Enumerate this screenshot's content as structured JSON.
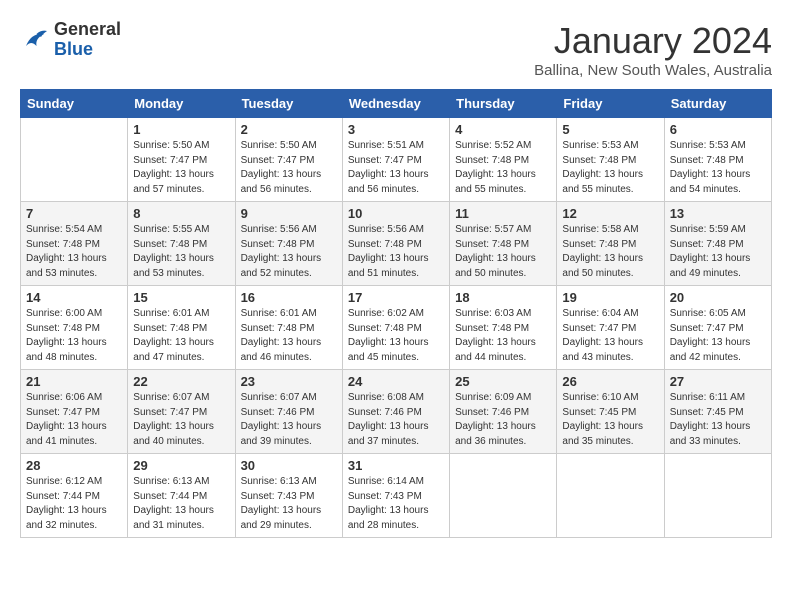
{
  "header": {
    "logo_general": "General",
    "logo_blue": "Blue",
    "title": "January 2024",
    "location": "Ballina, New South Wales, Australia"
  },
  "days_of_week": [
    "Sunday",
    "Monday",
    "Tuesday",
    "Wednesday",
    "Thursday",
    "Friday",
    "Saturday"
  ],
  "weeks": [
    [
      {
        "day": "",
        "sunrise": "",
        "sunset": "",
        "daylight": ""
      },
      {
        "day": "1",
        "sunrise": "5:50 AM",
        "sunset": "7:47 PM",
        "daylight": "13 hours and 57 minutes."
      },
      {
        "day": "2",
        "sunrise": "5:50 AM",
        "sunset": "7:47 PM",
        "daylight": "13 hours and 56 minutes."
      },
      {
        "day": "3",
        "sunrise": "5:51 AM",
        "sunset": "7:47 PM",
        "daylight": "13 hours and 56 minutes."
      },
      {
        "day": "4",
        "sunrise": "5:52 AM",
        "sunset": "7:48 PM",
        "daylight": "13 hours and 55 minutes."
      },
      {
        "day": "5",
        "sunrise": "5:53 AM",
        "sunset": "7:48 PM",
        "daylight": "13 hours and 55 minutes."
      },
      {
        "day": "6",
        "sunrise": "5:53 AM",
        "sunset": "7:48 PM",
        "daylight": "13 hours and 54 minutes."
      }
    ],
    [
      {
        "day": "7",
        "sunrise": "5:54 AM",
        "sunset": "7:48 PM",
        "daylight": "13 hours and 53 minutes."
      },
      {
        "day": "8",
        "sunrise": "5:55 AM",
        "sunset": "7:48 PM",
        "daylight": "13 hours and 53 minutes."
      },
      {
        "day": "9",
        "sunrise": "5:56 AM",
        "sunset": "7:48 PM",
        "daylight": "13 hours and 52 minutes."
      },
      {
        "day": "10",
        "sunrise": "5:56 AM",
        "sunset": "7:48 PM",
        "daylight": "13 hours and 51 minutes."
      },
      {
        "day": "11",
        "sunrise": "5:57 AM",
        "sunset": "7:48 PM",
        "daylight": "13 hours and 50 minutes."
      },
      {
        "day": "12",
        "sunrise": "5:58 AM",
        "sunset": "7:48 PM",
        "daylight": "13 hours and 50 minutes."
      },
      {
        "day": "13",
        "sunrise": "5:59 AM",
        "sunset": "7:48 PM",
        "daylight": "13 hours and 49 minutes."
      }
    ],
    [
      {
        "day": "14",
        "sunrise": "6:00 AM",
        "sunset": "7:48 PM",
        "daylight": "13 hours and 48 minutes."
      },
      {
        "day": "15",
        "sunrise": "6:01 AM",
        "sunset": "7:48 PM",
        "daylight": "13 hours and 47 minutes."
      },
      {
        "day": "16",
        "sunrise": "6:01 AM",
        "sunset": "7:48 PM",
        "daylight": "13 hours and 46 minutes."
      },
      {
        "day": "17",
        "sunrise": "6:02 AM",
        "sunset": "7:48 PM",
        "daylight": "13 hours and 45 minutes."
      },
      {
        "day": "18",
        "sunrise": "6:03 AM",
        "sunset": "7:48 PM",
        "daylight": "13 hours and 44 minutes."
      },
      {
        "day": "19",
        "sunrise": "6:04 AM",
        "sunset": "7:47 PM",
        "daylight": "13 hours and 43 minutes."
      },
      {
        "day": "20",
        "sunrise": "6:05 AM",
        "sunset": "7:47 PM",
        "daylight": "13 hours and 42 minutes."
      }
    ],
    [
      {
        "day": "21",
        "sunrise": "6:06 AM",
        "sunset": "7:47 PM",
        "daylight": "13 hours and 41 minutes."
      },
      {
        "day": "22",
        "sunrise": "6:07 AM",
        "sunset": "7:47 PM",
        "daylight": "13 hours and 40 minutes."
      },
      {
        "day": "23",
        "sunrise": "6:07 AM",
        "sunset": "7:46 PM",
        "daylight": "13 hours and 39 minutes."
      },
      {
        "day": "24",
        "sunrise": "6:08 AM",
        "sunset": "7:46 PM",
        "daylight": "13 hours and 37 minutes."
      },
      {
        "day": "25",
        "sunrise": "6:09 AM",
        "sunset": "7:46 PM",
        "daylight": "13 hours and 36 minutes."
      },
      {
        "day": "26",
        "sunrise": "6:10 AM",
        "sunset": "7:45 PM",
        "daylight": "13 hours and 35 minutes."
      },
      {
        "day": "27",
        "sunrise": "6:11 AM",
        "sunset": "7:45 PM",
        "daylight": "13 hours and 33 minutes."
      }
    ],
    [
      {
        "day": "28",
        "sunrise": "6:12 AM",
        "sunset": "7:44 PM",
        "daylight": "13 hours and 32 minutes."
      },
      {
        "day": "29",
        "sunrise": "6:13 AM",
        "sunset": "7:44 PM",
        "daylight": "13 hours and 31 minutes."
      },
      {
        "day": "30",
        "sunrise": "6:13 AM",
        "sunset": "7:43 PM",
        "daylight": "13 hours and 29 minutes."
      },
      {
        "day": "31",
        "sunrise": "6:14 AM",
        "sunset": "7:43 PM",
        "daylight": "13 hours and 28 minutes."
      },
      {
        "day": "",
        "sunrise": "",
        "sunset": "",
        "daylight": ""
      },
      {
        "day": "",
        "sunrise": "",
        "sunset": "",
        "daylight": ""
      },
      {
        "day": "",
        "sunrise": "",
        "sunset": "",
        "daylight": ""
      }
    ]
  ],
  "labels": {
    "sunrise": "Sunrise:",
    "sunset": "Sunset:",
    "daylight": "Daylight:"
  }
}
